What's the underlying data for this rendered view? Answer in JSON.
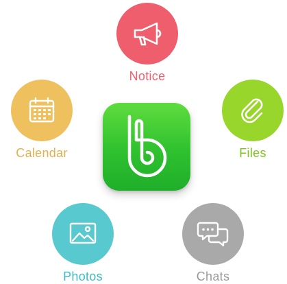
{
  "app_icon": {
    "icon": "band-b-logo",
    "color": "#2fc12f"
  },
  "features": [
    {
      "label": "Notice",
      "icon": "megaphone-icon",
      "color": "#ee5e6c"
    },
    {
      "label": "Calendar",
      "icon": "calendar-icon",
      "color": "#efc05e"
    },
    {
      "label": "Files",
      "icon": "paperclip-icon",
      "color": "#98d62c"
    },
    {
      "label": "Photos",
      "icon": "image-icon",
      "color": "#57c9cf"
    },
    {
      "label": "Chats",
      "icon": "chat-bubbles-icon",
      "color": "#a9a9a9"
    }
  ]
}
